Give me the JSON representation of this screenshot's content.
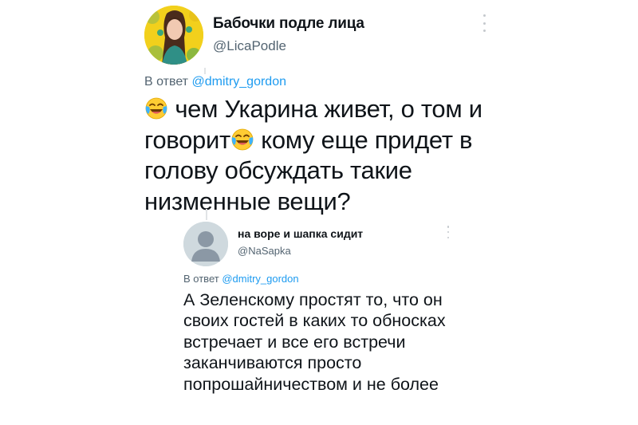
{
  "tweet1": {
    "author_name": "Бабочки подле лица",
    "handle": "@LicaPodle",
    "reply_prefix": "В ответ",
    "reply_mention": "@dmitry_gordon",
    "text_part1": "чем Укарина живет, о том и говорит",
    "text_part2": "кому еще придет в голову обсуждать такие низменные вещи?",
    "emoji_icon": "face-with-tears-of-joy-icon",
    "more_icon": "more-options-icon"
  },
  "tweet2": {
    "author_name": "на воре и шапка сидит",
    "handle": "@NaSapka",
    "reply_prefix": "В ответ",
    "reply_mention": "@dmitry_gordon",
    "text": "А Зеленскому простят то, что он своих гостей в каких то обносках встречает и все его встречи заканчиваются просто попрошайничеством и не более",
    "avatar_icon": "default-profile-icon",
    "more_icon": "more-options-icon"
  },
  "colors": {
    "text_primary": "#0f1419",
    "text_secondary": "#536471",
    "link": "#1d9bf0",
    "avatar_default_bg": "#cfd9de"
  }
}
